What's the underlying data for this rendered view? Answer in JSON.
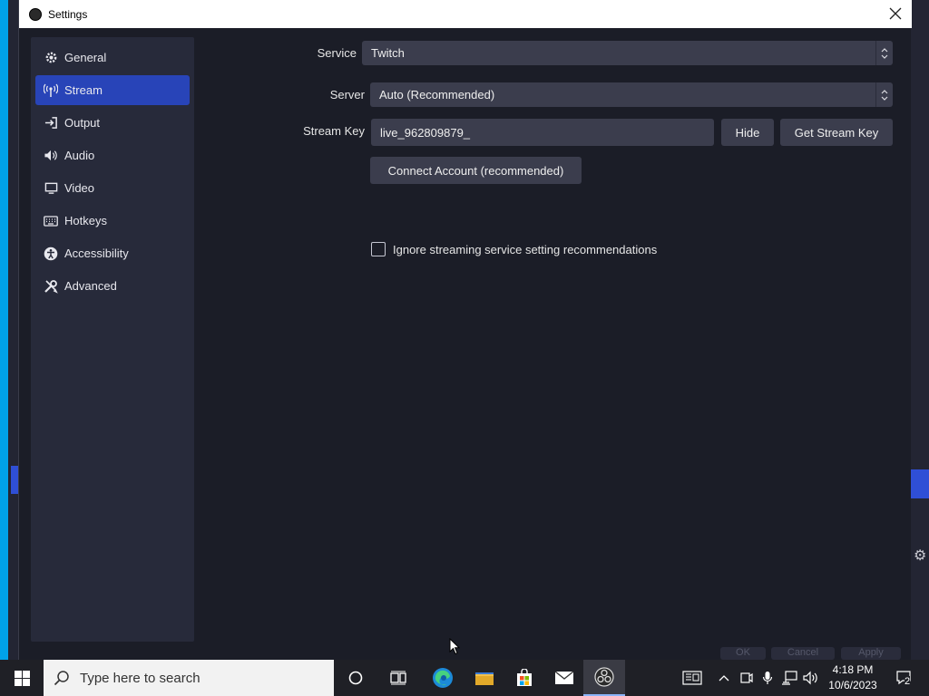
{
  "dialog": {
    "title": "Settings",
    "close_glyph": "✕"
  },
  "sidebar": {
    "items": [
      {
        "label": "General",
        "icon": "gear-icon"
      },
      {
        "label": "Stream",
        "icon": "antenna-icon",
        "active": true
      },
      {
        "label": "Output",
        "icon": "output-icon"
      },
      {
        "label": "Audio",
        "icon": "speaker-icon"
      },
      {
        "label": "Video",
        "icon": "monitor-icon"
      },
      {
        "label": "Hotkeys",
        "icon": "keyboard-icon"
      },
      {
        "label": "Accessibility",
        "icon": "accessibility-icon"
      },
      {
        "label": "Advanced",
        "icon": "tools-icon"
      }
    ]
  },
  "stream": {
    "service_label": "Service",
    "service_value": "Twitch",
    "server_label": "Server",
    "server_value": "Auto (Recommended)",
    "key_label": "Stream Key",
    "key_value": "live_962809879_",
    "hide_button": "Hide",
    "get_key_button": "Get Stream Key",
    "connect_button": "Connect Account (recommended)",
    "ignore_checkbox_label": "Ignore streaming service setting recommendations",
    "ignore_checked": false
  },
  "footer": {
    "ok": "OK",
    "cancel": "Cancel",
    "apply": "Apply"
  },
  "taskbar": {
    "search_placeholder": "Type here to search",
    "time": "4:18 PM",
    "date": "10/6/2023",
    "notification_count": "2"
  },
  "colors": {
    "accent": "#2844b8",
    "dialog_bg": "#1b1d27",
    "sidebar_bg": "#272a3a",
    "control_bg": "#3b3d4d"
  }
}
